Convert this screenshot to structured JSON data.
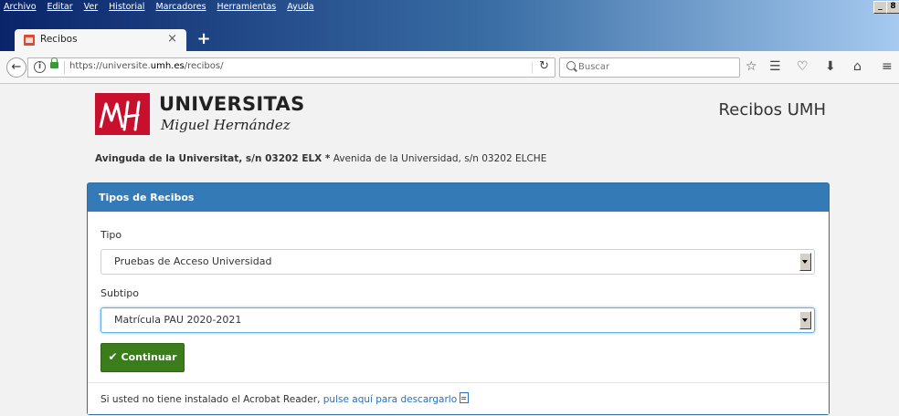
{
  "menubar": {
    "items": [
      "Archivo",
      "Editar",
      "Ver",
      "Historial",
      "Marcadores",
      "Herramientas",
      "Ayuda"
    ],
    "window_controls": [
      "_",
      "8"
    ]
  },
  "tabs": [
    {
      "title": "Recibos",
      "close": "×",
      "favicon": "umh-favicon"
    }
  ],
  "new_tab_label": "+",
  "navbar": {
    "back_icon": "back-arrow-icon",
    "info_icon": "i",
    "url_prefix": "https://universite.",
    "url_host": "umh.es",
    "url_suffix": "/recibos/",
    "reload_icon": "reload-icon",
    "search_placeholder": "Buscar",
    "toolbar_icons": [
      "star-icon",
      "reading-list-icon",
      "pocket-icon",
      "download-icon",
      "home-icon",
      "menu-icon"
    ]
  },
  "header": {
    "logo_text_1": "UNIVERSITAS",
    "logo_text_2": "Miguel Hernández",
    "brand_right": "Recibos UMH",
    "address_bold": "Avinguda de la Universitat, s/n 03202 ELX *",
    "address_rest": " Avenida de la Universidad, s/n 03202 ELCHE"
  },
  "panel": {
    "title": "Tipos de Recibos",
    "tipo_label": "Tipo",
    "tipo_value": "Pruebas de Acceso Universidad",
    "subtipo_label": "Subtipo",
    "subtipo_value": "Matrícula PAU 2020-2021",
    "continue_label": "Continuar",
    "footer_text": "Si usted no tiene instalado el Acrobat Reader, ",
    "footer_link": "pulse aquí para descargarlo"
  },
  "colors": {
    "panel_header": "#337ab7",
    "button": "#3a7d1a",
    "link": "#2a6fb8",
    "logo_red": "#c8102e"
  }
}
